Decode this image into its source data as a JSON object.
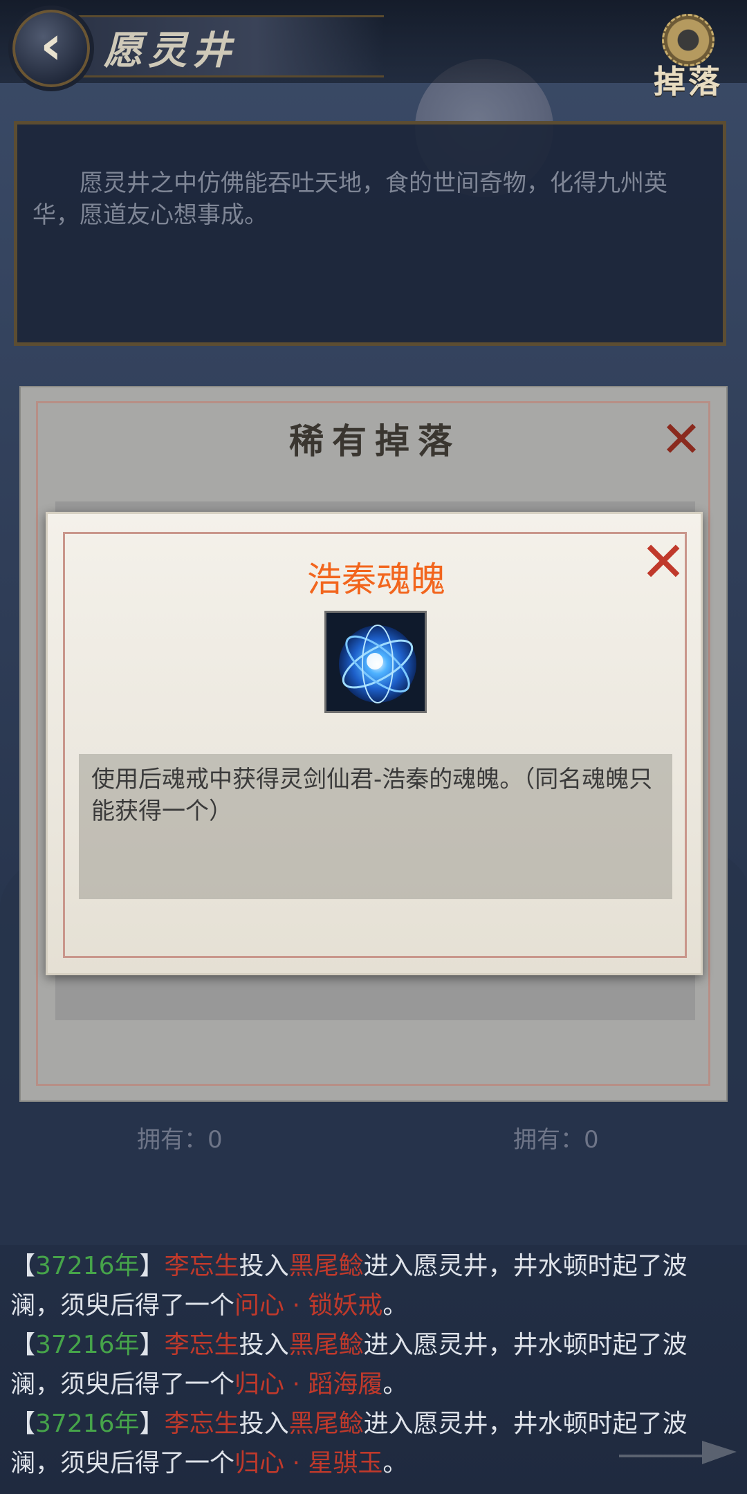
{
  "header": {
    "title": "愿灵井",
    "back_icon": "back-arrow-icon",
    "drops_label": "掉落"
  },
  "description": "愿灵井之中仿佛能吞吐天地，食的世间奇物，化得九州英华，愿道友心想事成。",
  "rare_modal": {
    "title": "稀有掉落"
  },
  "item_modal": {
    "name": "浩秦魂魄",
    "description": "使用后魂戒中获得灵剑仙君-浩秦的魂魄。（同名魂魄只能获得一个）"
  },
  "owned": {
    "left": "拥有：0",
    "right": "拥有：0"
  },
  "log": [
    {
      "open": "【",
      "year": "37216年",
      "close": "】",
      "player": "李忘生",
      "t1": "投入",
      "bait": "黑尾鲶",
      "t2": "进入愿灵井，井水顿时起了波澜，须臾后得了一个",
      "item": "问心 · 锁妖戒",
      "end": "。"
    },
    {
      "open": "【",
      "year": "37216年",
      "close": "】",
      "player": "李忘生",
      "t1": "投入",
      "bait": "黑尾鲶",
      "t2": "进入愿灵井，井水顿时起了波澜，须臾后得了一个",
      "item": "归心 · 蹈海履",
      "end": "。"
    },
    {
      "open": "【",
      "year": "37216年",
      "close": "】",
      "player": "李忘生",
      "t1": "投入",
      "bait": "黑尾鲶",
      "t2": "进入愿灵井，井水顿时起了波澜，须臾后得了一个",
      "item": "归心 · 星骐玉",
      "end": "。"
    }
  ],
  "colors": {
    "year": "#46a44a",
    "highlight": "#c0392b",
    "item_title": "#f2651d"
  }
}
